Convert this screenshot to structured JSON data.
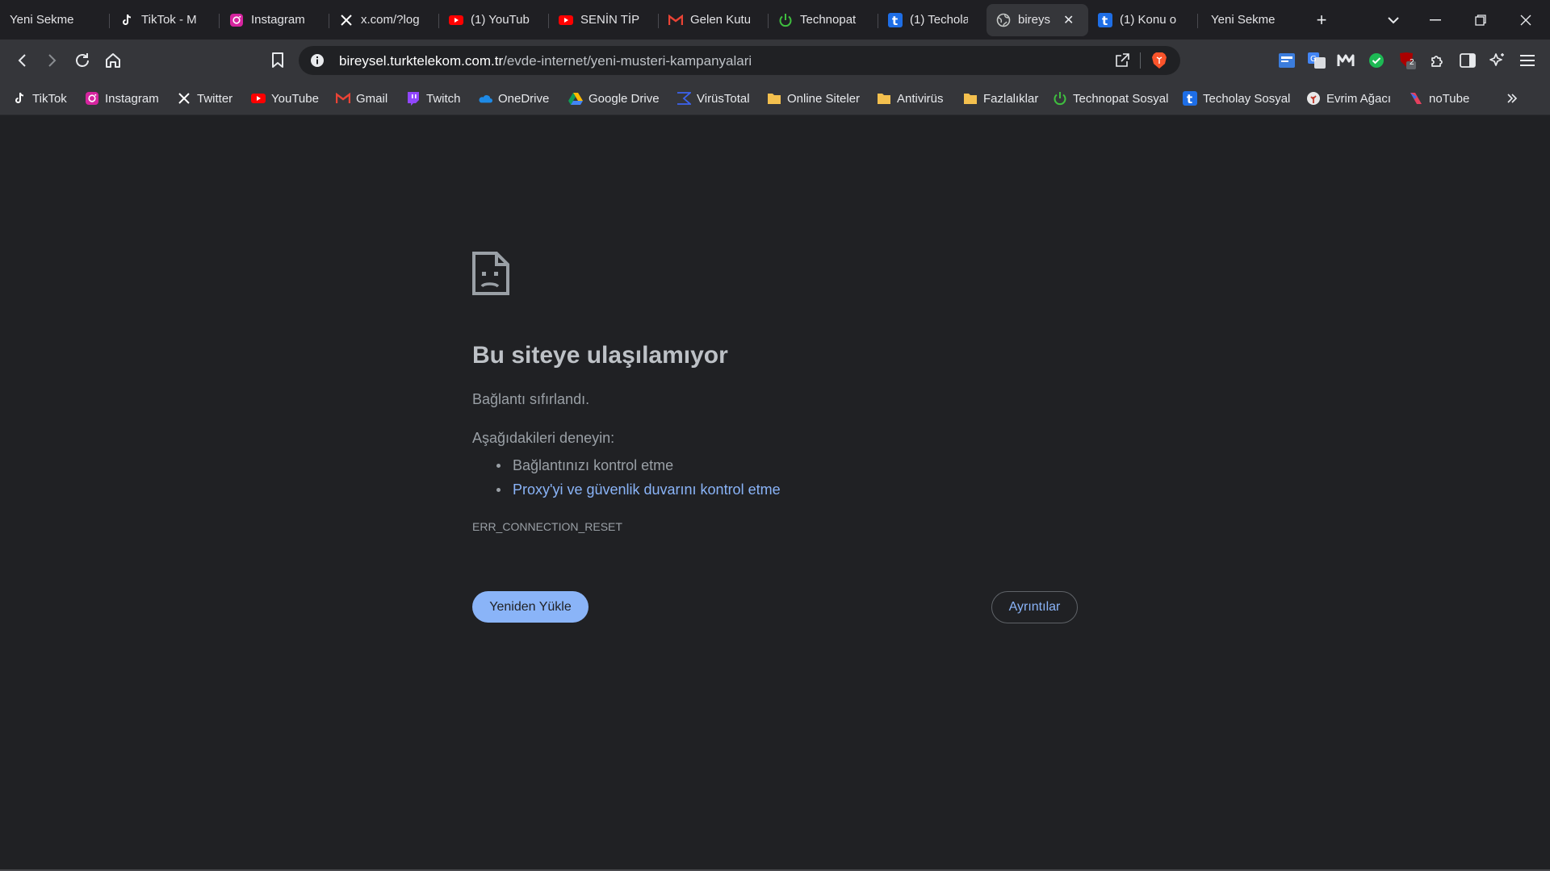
{
  "tabs": [
    {
      "title": "Yeni Sekme",
      "icon": "none"
    },
    {
      "title": "TikTok - M",
      "icon": "tiktok-icon"
    },
    {
      "title": "Instagram",
      "icon": "instagram-icon"
    },
    {
      "title": "x.com/?log",
      "icon": "x-icon"
    },
    {
      "title": "(1) YouTub",
      "icon": "youtube-icon"
    },
    {
      "title": "SENİN TİPİ",
      "icon": "youtube-icon"
    },
    {
      "title": "Gelen Kutu",
      "icon": "gmail-icon"
    },
    {
      "title": "Technopat",
      "icon": "technopat-icon"
    },
    {
      "title": "(1) Techola",
      "icon": "techolay-icon"
    },
    {
      "title": "bireys",
      "icon": "globe-icon",
      "active": true
    },
    {
      "title": "(1) Konu o",
      "icon": "techolay-icon"
    },
    {
      "title": "Yeni Sekme",
      "icon": "none"
    }
  ],
  "address_bar": {
    "host": "bireysel.turktelekom.com.tr",
    "path": "/evde-internet/yeni-musteri-kampanyalari"
  },
  "bookmarks": [
    {
      "label": "TikTok",
      "icon": "tiktok-icon"
    },
    {
      "label": "Instagram",
      "icon": "instagram-icon"
    },
    {
      "label": "Twitter",
      "icon": "x-icon"
    },
    {
      "label": "YouTube",
      "icon": "youtube-icon"
    },
    {
      "label": "Gmail",
      "icon": "gmail-icon"
    },
    {
      "label": "Twitch",
      "icon": "twitch-icon"
    },
    {
      "label": "OneDrive",
      "icon": "onedrive-icon"
    },
    {
      "label": "Google Drive",
      "icon": "google-drive-icon"
    },
    {
      "label": "VirüsTotal",
      "icon": "virustotal-icon"
    },
    {
      "label": "Online Siteler",
      "icon": "folder-icon"
    },
    {
      "label": "Antivirüs",
      "icon": "folder-icon"
    },
    {
      "label": "Fazlalıklar",
      "icon": "folder-icon"
    },
    {
      "label": "Technopat Sosyal",
      "icon": "technopat-icon"
    },
    {
      "label": "Techolay Sosyal",
      "icon": "techolay-icon"
    },
    {
      "label": "Evrim Ağacı",
      "icon": "evrim-agaci-icon"
    },
    {
      "label": "noTube",
      "icon": "notube-icon"
    }
  ],
  "error_page": {
    "title": "Bu siteye ulaşılamıyor",
    "subtitle": "Bağlantı sıfırlandı.",
    "try_heading": "Aşağıdakileri deneyin:",
    "suggestions": [
      "Bağlantınızı kontrol etme",
      "Proxy'yi ve güvenlik duvarını kontrol etme"
    ],
    "error_code": "ERR_CONNECTION_RESET",
    "reload_label": "Yeniden Yükle",
    "details_label": "Ayrıntılar"
  },
  "extensions": {
    "ublock_badge": "2"
  },
  "colors": {
    "accent": "#8ab4f8",
    "page_bg": "#202124",
    "toolbar_bg": "#35363a"
  }
}
